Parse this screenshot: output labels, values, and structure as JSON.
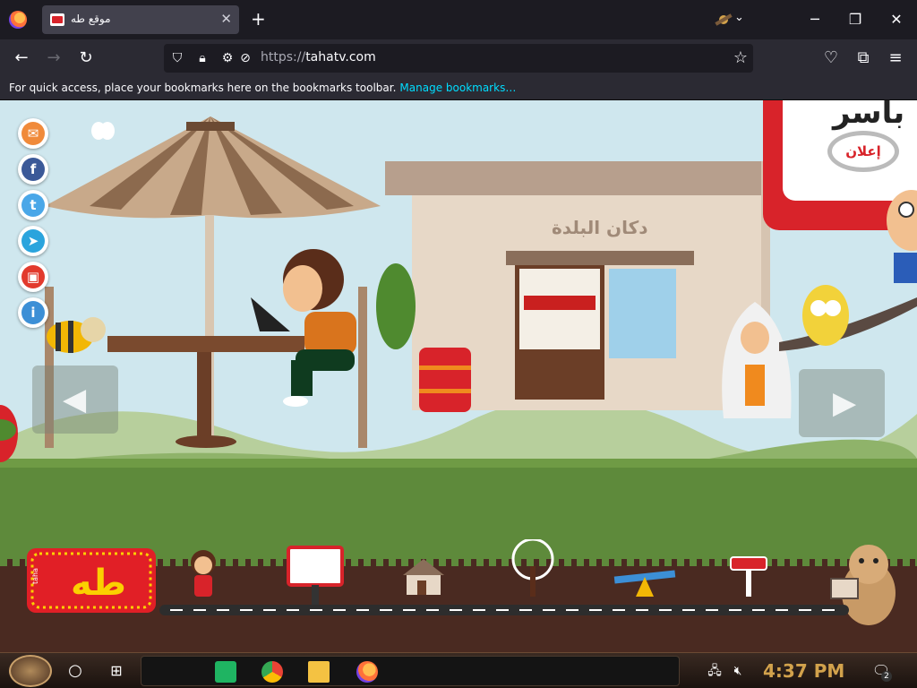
{
  "browser": {
    "tab_title": "موقع طه",
    "url_scheme": "https://",
    "url_host": "tahatv.com",
    "bookmarks_hint": "For quick access, place your bookmarks here on the bookmarks toolbar.",
    "manage_bookmarks": "Manage bookmarks…"
  },
  "page": {
    "shop_sign": "دكان البلدة",
    "ad_button": "إعلان",
    "ad_heading": "باسر",
    "logo_text": "طه",
    "logo_side": "taha"
  },
  "taskbar": {
    "clock": "4:37 PM",
    "notification_count": "2"
  }
}
